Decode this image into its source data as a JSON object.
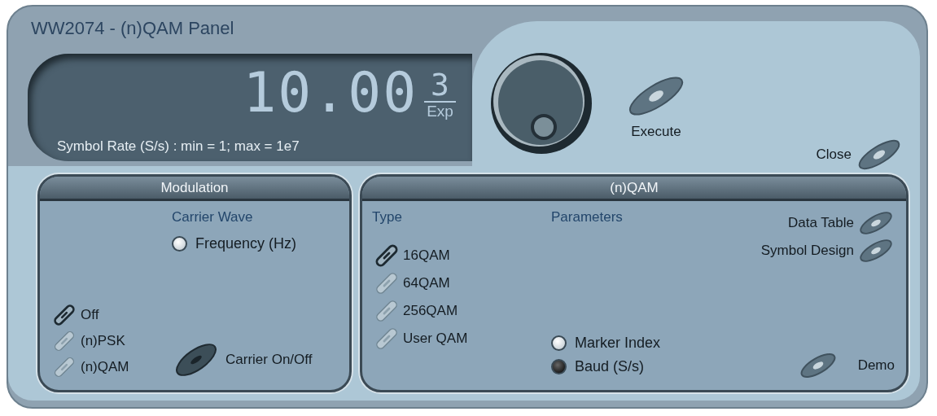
{
  "window": {
    "title": "WW2074 - (n)QAM Panel"
  },
  "display": {
    "value": "10.00",
    "exponent": "3",
    "exponent_label": "Exp",
    "caption": "Symbol Rate (S/s) : min = 1; max = 1e7"
  },
  "buttons": [
    {
      "label": "Execute"
    },
    {
      "label": "Close"
    }
  ],
  "modulation": {
    "title": "Modulation",
    "carrier_heading": "Carrier Wave",
    "carrier_options": [
      {
        "label": "Frequency (Hz)",
        "selected": false
      }
    ],
    "modes": [
      {
        "label": "Off",
        "selected": true
      },
      {
        "label": "(n)PSK",
        "selected": false
      },
      {
        "label": "(n)QAM",
        "selected": false
      }
    ],
    "carrier_toggle": {
      "label": "Carrier On/Off"
    }
  },
  "qam": {
    "title": "(n)QAM",
    "type_heading": "Type",
    "types": [
      {
        "label": "16QAM",
        "selected": true
      },
      {
        "label": "64QAM",
        "selected": false
      },
      {
        "label": "256QAM",
        "selected": false
      },
      {
        "label": "User QAM",
        "selected": false
      }
    ],
    "parameters_heading": "Parameters",
    "parameters": [
      {
        "label": "Marker Index",
        "selected": false
      },
      {
        "label": "Baud (S/s)",
        "selected": true
      }
    ],
    "actions": [
      {
        "label": "Data Table"
      },
      {
        "label": "Symbol Design"
      }
    ],
    "demo_button": {
      "label": "Demo"
    }
  }
}
